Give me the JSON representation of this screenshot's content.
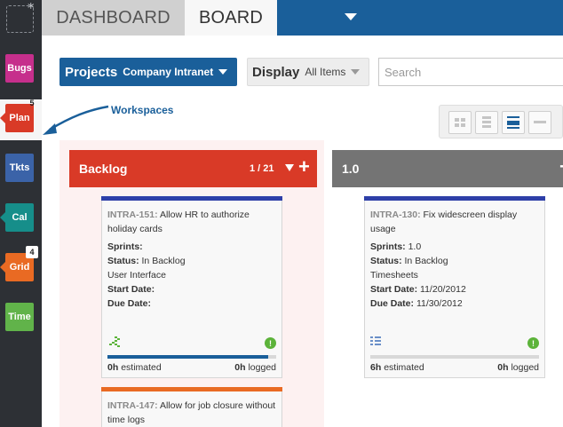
{
  "sidebar": {
    "apps": [
      {
        "label": "Bugs",
        "color": "#c62f8c",
        "badge": ""
      },
      {
        "label": "Plan",
        "color": "#d93a27",
        "badge": "5"
      },
      {
        "label": "Tkts",
        "color": "#3b63a8",
        "badge": ""
      },
      {
        "label": "Cal",
        "color": "#168e8a",
        "badge": ""
      },
      {
        "label": "Grid",
        "color": "#e96a23",
        "badge": "4"
      },
      {
        "label": "Time",
        "color": "#61b34a",
        "badge": ""
      }
    ]
  },
  "tabs": {
    "dashboard": "DASHBOARD",
    "board": "BOARD"
  },
  "toolbar": {
    "projects_label": "Projects",
    "projects_value": "Company Intranet",
    "display_label": "Display",
    "display_value": "All Items",
    "search_placeholder": "Search"
  },
  "annotation": {
    "workspaces": "Workspaces"
  },
  "columns": [
    {
      "title": "Backlog",
      "count": "1 / 21",
      "cards": [
        {
          "key": "INTRA-151:",
          "title": "Allow HR to authorize holiday cards",
          "strip_color": "#2e3fa8",
          "sprints_label": "Sprints:",
          "sprints_value": "",
          "status_label": "Status:",
          "status_value": "In Backlog",
          "category": "User Interface",
          "start_label": "Start Date:",
          "start_value": "",
          "due_label": "Due Date:",
          "due_value": "",
          "progress": 0.95,
          "estimated_num": "0h",
          "estimated_label": "estimated",
          "logged_num": "0h",
          "logged_label": "logged"
        },
        {
          "key": "INTRA-147:",
          "title": "Allow for job closure without time logs",
          "strip_color": "#e96a23"
        }
      ]
    },
    {
      "title": "1.0",
      "cards": [
        {
          "key": "INTRA-130:",
          "title": "Fix widescreen display usage",
          "strip_color": "#2e3fa8",
          "sprints_label": "Sprints:",
          "sprints_value": "1.0",
          "status_label": "Status:",
          "status_value": "In Backlog",
          "category": "Timesheets",
          "start_label": "Start Date:",
          "start_value": "11/20/2012",
          "due_label": "Due Date:",
          "due_value": "11/30/2012",
          "progress": 0.0,
          "estimated_num": "6h",
          "estimated_label": "estimated",
          "logged_num": "0h",
          "logged_label": "logged"
        }
      ]
    }
  ]
}
